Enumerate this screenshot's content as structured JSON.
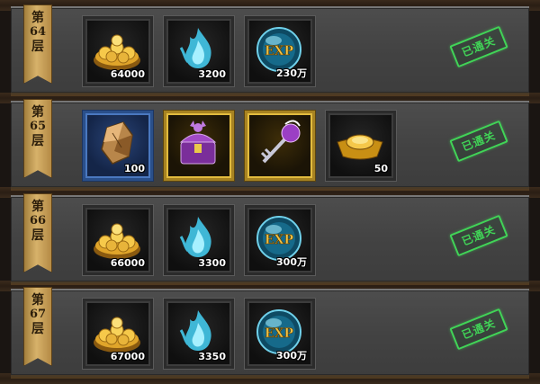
{
  "rows": [
    {
      "banner": [
        "第",
        "64",
        "层"
      ],
      "status": "已通关",
      "rewards": [
        {
          "icon": "gold-coins-icon",
          "qty": "64000",
          "frame": "gray"
        },
        {
          "icon": "blue-soul-flame-icon",
          "qty": "3200",
          "frame": "gray"
        },
        {
          "icon": "exp-orb-icon",
          "qty": "230万",
          "label": "EXP",
          "frame": "gray"
        }
      ]
    },
    {
      "banner": [
        "第",
        "65",
        "层"
      ],
      "status": "已通关",
      "rewards": [
        {
          "icon": "ore-stone-icon",
          "qty": "100",
          "frame": "blue"
        },
        {
          "icon": "purple-treasure-chest-icon",
          "qty": "",
          "frame": "gold"
        },
        {
          "icon": "purple-key-icon",
          "qty": "",
          "frame": "gold"
        },
        {
          "icon": "gold-ingot-icon",
          "qty": "50",
          "frame": "gray"
        }
      ]
    },
    {
      "banner": [
        "第",
        "66",
        "层"
      ],
      "status": "已通关",
      "rewards": [
        {
          "icon": "gold-coins-icon",
          "qty": "66000",
          "frame": "gray"
        },
        {
          "icon": "blue-soul-flame-icon",
          "qty": "3300",
          "frame": "gray"
        },
        {
          "icon": "exp-orb-icon",
          "qty": "300万",
          "label": "EXP",
          "frame": "gray"
        }
      ]
    },
    {
      "banner": [
        "第",
        "67",
        "层"
      ],
      "status": "已通关",
      "rewards": [
        {
          "icon": "gold-coins-icon",
          "qty": "67000",
          "frame": "gray"
        },
        {
          "icon": "blue-soul-flame-icon",
          "qty": "3350",
          "frame": "gray"
        },
        {
          "icon": "exp-orb-icon",
          "qty": "300万",
          "label": "EXP",
          "frame": "gray"
        }
      ]
    }
  ],
  "colors": {
    "stamp": "#41d457",
    "banner": "#d7b26a",
    "panel": "#474747"
  }
}
